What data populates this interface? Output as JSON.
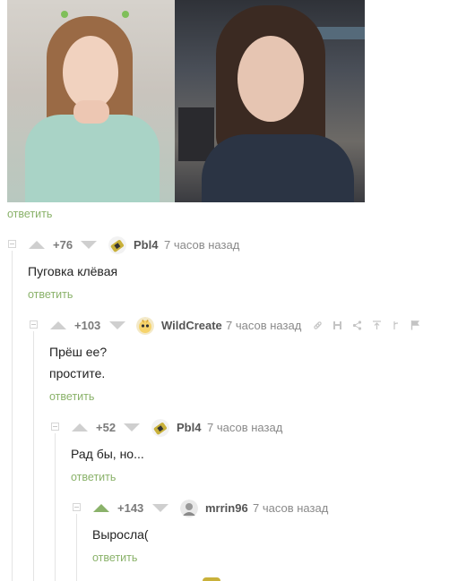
{
  "post": {
    "reply_label": "ответить"
  },
  "comments": [
    {
      "rating": "+76",
      "username": "Pbl4",
      "timestamp": "7 часов назад",
      "lines": [
        "Пуговка клёвая"
      ],
      "reply_label": "ответить",
      "vote": "none"
    },
    {
      "rating": "+103",
      "username": "WildCreate",
      "timestamp": "7 часов назад",
      "lines": [
        "Прёш ее?",
        "простите."
      ],
      "reply_label": "ответить",
      "vote": "none"
    },
    {
      "rating": "+52",
      "username": "Pbl4",
      "timestamp": "7 часов назад",
      "lines": [
        "Рад бы, но..."
      ],
      "reply_label": "ответить",
      "vote": "none"
    },
    {
      "rating": "+143",
      "username": "mrrin96",
      "timestamp": "7 часов назад",
      "lines": [
        "Выросла("
      ],
      "reply_label": "ответить",
      "vote": "up"
    }
  ],
  "toolbar_icons": [
    "link-icon",
    "save-icon",
    "share-icon",
    "scroll-up-icon",
    "branch-icon",
    "flag-icon"
  ],
  "colors": {
    "accent_green": "#8ab26a",
    "vote_gray": "#cfcfcf",
    "rail_gray": "#e4e4e4"
  }
}
